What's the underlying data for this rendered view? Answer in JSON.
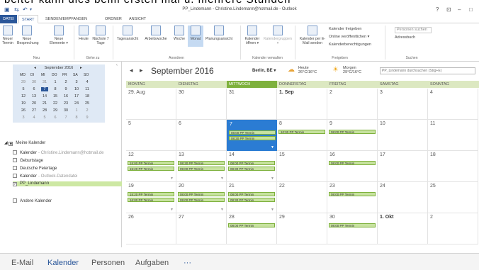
{
  "top_text": "beiter kann dies beim ersten mal u. mehrere Stunden",
  "window": {
    "title": "PP_Lindemann - Christine.Lindemann@hotmail.de - Outlook",
    "help": "?",
    "restore": "⊡",
    "minimize": "–",
    "maximize": "□"
  },
  "tabs": [
    "DATEI",
    "START",
    "SENDEN/EMPFANGEN",
    "ORDNER",
    "ANSICHT"
  ],
  "ribbon": {
    "new_appointment": "Neuer Termin",
    "new_meeting": "Neue Besprechung",
    "new_items": "Neue Elemente ▾",
    "group_new": "Neu",
    "today": "Heute",
    "next7": "Nächste 7 Tage",
    "group_goto": "Gehe zu",
    "day": "Tagesansicht",
    "workweek": "Arbeitswoche",
    "week": "Woche",
    "month": "Monat",
    "schedule": "Planungsansicht",
    "group_arrange": "Anordnen",
    "open_calendar": "Kalender öffnen ▾",
    "calendar_groups": "Kalendergruppen ▾",
    "group_manage": "Kalender verwalten",
    "email_calendar": "Kalender per E-Mail senden",
    "share_calendar": "Kalender freigeben",
    "publish_online": "Online veröffentlichen ▾",
    "calendar_permissions": "Kalenderberechtigungen",
    "group_share": "Freigeben",
    "search_people_placeholder": "Personen suchen",
    "address_book": "Adressbuch",
    "group_find": "Suchen"
  },
  "mini_calendar": {
    "title": "September 2016",
    "prev": "◂",
    "next": "▸",
    "day_names": [
      "MO",
      "DI",
      "MI",
      "DO",
      "FR",
      "SA",
      "SO"
    ],
    "weeks": [
      [
        "29",
        "30",
        "31",
        "1",
        "2",
        "3",
        "4"
      ],
      [
        "5",
        "6",
        "7",
        "8",
        "9",
        "10",
        "11"
      ],
      [
        "12",
        "13",
        "14",
        "15",
        "16",
        "17",
        "18"
      ],
      [
        "19",
        "20",
        "21",
        "22",
        "23",
        "24",
        "25"
      ],
      [
        "26",
        "27",
        "28",
        "29",
        "30",
        "1",
        "2"
      ],
      [
        "3",
        "4",
        "5",
        "6",
        "7",
        "8",
        "9"
      ]
    ]
  },
  "folders": {
    "my_calendars": "Meine Kalender",
    "items": [
      {
        "label": "Kalender",
        "sub": "- Christine.Lindemann@hotmail.de",
        "checked": false
      },
      {
        "label": "Geburtstage",
        "sub": "",
        "checked": false
      },
      {
        "label": "Deutsche Feiertage",
        "sub": "",
        "checked": false
      },
      {
        "label": "Kalender",
        "sub": "- Outlook-Datendatei",
        "checked": false
      },
      {
        "label": "PP_Lindemann",
        "sub": "",
        "checked": true
      }
    ],
    "other_calendars": "Andere Kalender"
  },
  "calendar": {
    "prev": "◂",
    "next": "▸",
    "month_title": "September 2016",
    "location": "Berlin, BE ▾",
    "weather_today_label": "Heute",
    "weather_today": "26°C/16°C",
    "weather_tomorrow_label": "Morgen",
    "weather_tomorrow": "29°C/16°C",
    "search_placeholder": "PP_Lindemann durchsuchen (Strg+E)",
    "day_headers": [
      "MONTAG",
      "DIENSTAG",
      "MITTWOCH",
      "DONNERSTAG",
      "FREITAG",
      "SAMSTAG",
      "SONNTAG"
    ],
    "weeks": [
      [
        {
          "d": "29. Aug",
          "e": []
        },
        {
          "d": "30",
          "e": []
        },
        {
          "d": "31",
          "e": []
        },
        {
          "d": "1. Sep",
          "e": [],
          "b": true
        },
        {
          "d": "2",
          "e": []
        },
        {
          "d": "3",
          "e": []
        },
        {
          "d": "4",
          "e": []
        }
      ],
      [
        {
          "d": "5",
          "e": []
        },
        {
          "d": "6",
          "e": []
        },
        {
          "d": "7",
          "e": [
            "08:00 PP Termin",
            "08:30 PP Termin"
          ],
          "today": true
        },
        {
          "d": "8",
          "e": [
            "10:00 PP Termin"
          ]
        },
        {
          "d": "9",
          "e": [
            "08:00 PP Termin"
          ]
        },
        {
          "d": "10",
          "e": []
        },
        {
          "d": "11",
          "e": []
        }
      ],
      [
        {
          "d": "12",
          "e": [
            "15:00 PP Termin",
            "15:20 PP Termin"
          ]
        },
        {
          "d": "13",
          "e": [
            "08:30 PP Termin",
            "09:00 PP Termin"
          ]
        },
        {
          "d": "14",
          "e": [
            "08:00 PP Termin",
            "08:30 PP Termin"
          ]
        },
        {
          "d": "15",
          "e": []
        },
        {
          "d": "16",
          "e": [
            "08:00 PP Termin"
          ]
        },
        {
          "d": "17",
          "e": []
        },
        {
          "d": "18",
          "e": []
        }
      ],
      [
        {
          "d": "19",
          "e": [
            "15:20 PP Termin",
            "16:00 PP Termin"
          ]
        },
        {
          "d": "20",
          "e": [
            "08:00 PP Termin",
            "09:00 PP Termin"
          ]
        },
        {
          "d": "21",
          "e": [
            "08:00 PP Termin",
            "08:30 PP Termin"
          ]
        },
        {
          "d": "22",
          "e": []
        },
        {
          "d": "23",
          "e": [
            "08:00 PP Termin"
          ]
        },
        {
          "d": "24",
          "e": []
        },
        {
          "d": "25",
          "e": []
        }
      ],
      [
        {
          "d": "26",
          "e": []
        },
        {
          "d": "27",
          "e": []
        },
        {
          "d": "28",
          "e": [
            "08:00 PP Termin"
          ]
        },
        {
          "d": "29",
          "e": []
        },
        {
          "d": "30",
          "e": [
            "08:00 PP Termin"
          ]
        },
        {
          "d": "1. Okt",
          "e": [],
          "b": true
        },
        {
          "d": "2",
          "e": []
        }
      ]
    ]
  },
  "bottom_nav": [
    "E-Mail",
    "Kalender",
    "Personen",
    "Aufgaben",
    "···"
  ],
  "colors": {
    "accent": "#2b579a",
    "today": "#2b7cd3",
    "event": "#c7e29f",
    "header": "#dce8c1"
  }
}
